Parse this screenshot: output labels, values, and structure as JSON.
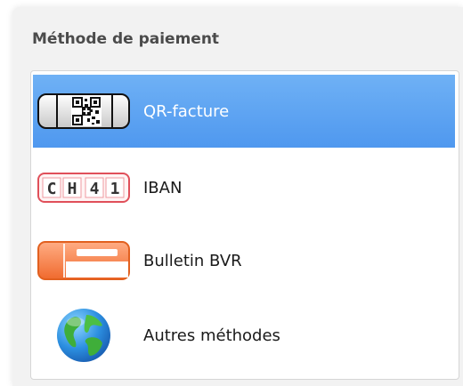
{
  "header": {
    "title": "Méthode de paiement"
  },
  "methods": [
    {
      "label": "QR-facture",
      "icon": "qr-bill-icon",
      "selected": true
    },
    {
      "label": "IBAN",
      "icon": "iban-icon",
      "selected": false,
      "icon_text": [
        "C",
        "H",
        "4",
        "1"
      ]
    },
    {
      "label": "Bulletin BVR",
      "icon": "payment-slip-icon",
      "selected": false
    },
    {
      "label": "Autres méthodes",
      "icon": "globe-icon",
      "selected": false
    }
  ],
  "colors": {
    "selection": "#5aa2f2",
    "iban_red": "#e0505a",
    "bvr_orange": "#f37a3e"
  }
}
